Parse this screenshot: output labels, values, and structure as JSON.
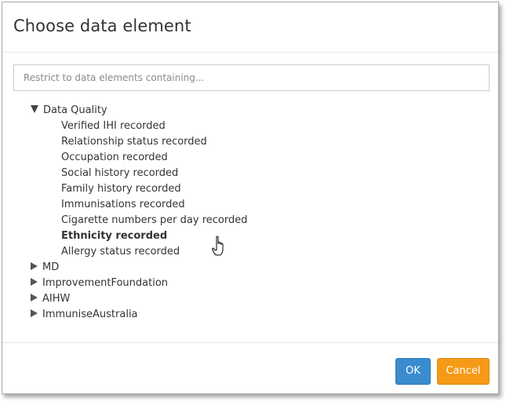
{
  "dialog": {
    "title": "Choose data element",
    "search_placeholder": "Restrict to data elements containing...",
    "search_value": ""
  },
  "tree": {
    "groups": [
      {
        "label": "Data Quality",
        "expanded": true,
        "children": [
          "Verified IHI recorded",
          "Relationship status recorded",
          "Occupation recorded",
          "Social history recorded",
          "Family history recorded",
          "Immunisations recorded",
          "Cigarette numbers per day recorded",
          "Ethnicity recorded",
          "Allergy status recorded"
        ],
        "hovered_child": "Ethnicity recorded"
      },
      {
        "label": "MD",
        "expanded": false
      },
      {
        "label": "ImprovementFoundation",
        "expanded": false
      },
      {
        "label": "AIHW",
        "expanded": false
      },
      {
        "label": "ImmuniseAustralia",
        "expanded": false
      }
    ]
  },
  "footer": {
    "ok_label": "OK",
    "cancel_label": "Cancel"
  },
  "colors": {
    "ok_button": "#3a8ccf",
    "cancel_button": "#f59a16",
    "text": "#333333",
    "border": "#a9a9a9"
  },
  "icons": {
    "expanded": "triangle-down-icon",
    "collapsed": "triangle-right-icon",
    "pointer": "hand-pointer-icon"
  }
}
